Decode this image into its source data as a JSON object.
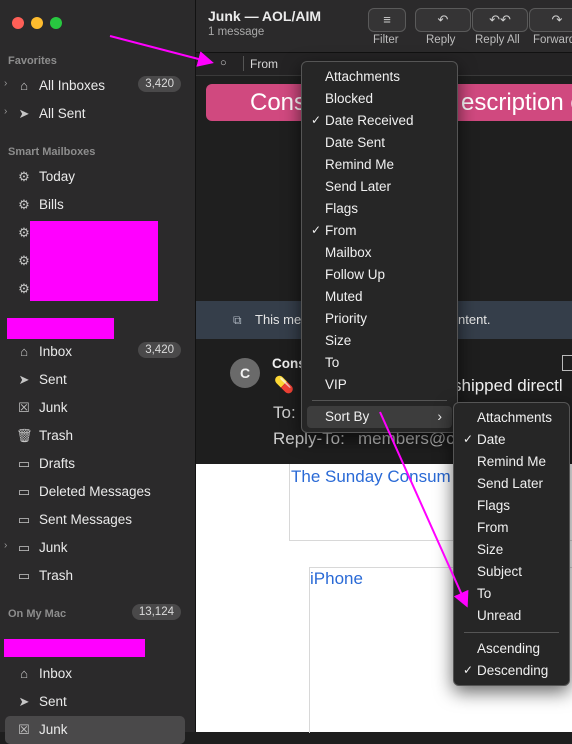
{
  "sidebar": {
    "favorites_title": "Favorites",
    "favorites": [
      {
        "label": "All Inboxes",
        "badge": "3,420"
      },
      {
        "label": "All Sent"
      }
    ],
    "smart_title": "Smart Mailboxes",
    "smart": [
      {
        "label": "Today"
      },
      {
        "label": "Bills"
      }
    ],
    "account": [
      {
        "label": "Inbox",
        "badge": "3,420"
      },
      {
        "label": "Sent"
      },
      {
        "label": "Junk"
      },
      {
        "label": "Trash"
      },
      {
        "label": "Drafts"
      },
      {
        "label": "Deleted Messages"
      },
      {
        "label": "Sent Messages"
      },
      {
        "label": "Junk"
      },
      {
        "label": "Trash"
      }
    ],
    "onmymac_title": "On My Mac",
    "onmymac_badge": "13,124",
    "mac": [
      {
        "label": "Inbox"
      },
      {
        "label": "Sent"
      },
      {
        "label": "Junk"
      }
    ]
  },
  "header": {
    "title": "Junk — AOL/AIM",
    "subtitle": "1 message"
  },
  "toolbar": {
    "filter": "Filter",
    "reply": "Reply",
    "reply_all": "Reply All",
    "forward": "Forward"
  },
  "list_header": {
    "sort_col": "From"
  },
  "banner_left": "Cons",
  "banner_right": "escription c",
  "infobar": {
    "left": "This me",
    "right": "ntent."
  },
  "message": {
    "avatar": "C",
    "sender": "Cons",
    "body_right": "shipped directl",
    "pill": "💊",
    "to_label": "To:",
    "replyto_label": "Reply-To:",
    "replyto_value": "members@c",
    "body1": "The Sunday Consum",
    "body2": "iPhone"
  },
  "columns_menu": {
    "items": [
      {
        "label": "Attachments",
        "checked": false
      },
      {
        "label": "Blocked",
        "checked": false
      },
      {
        "label": "Date Received",
        "checked": true
      },
      {
        "label": "Date Sent",
        "checked": false
      },
      {
        "label": "Remind Me",
        "checked": false
      },
      {
        "label": "Send Later",
        "checked": false
      },
      {
        "label": "Flags",
        "checked": false
      },
      {
        "label": "From",
        "checked": true
      },
      {
        "label": "Mailbox",
        "checked": false
      },
      {
        "label": "Follow Up",
        "checked": false
      },
      {
        "label": "Muted",
        "checked": false
      },
      {
        "label": "Priority",
        "checked": false
      },
      {
        "label": "Size",
        "checked": false
      },
      {
        "label": "To",
        "checked": false
      },
      {
        "label": "VIP",
        "checked": false
      }
    ],
    "sort_by": "Sort By"
  },
  "sort_menu": {
    "items": [
      {
        "label": "Attachments",
        "checked": false
      },
      {
        "label": "Date",
        "checked": true
      },
      {
        "label": "Remind Me",
        "checked": false
      },
      {
        "label": "Send Later",
        "checked": false
      },
      {
        "label": "Flags",
        "checked": false
      },
      {
        "label": "From",
        "checked": false
      },
      {
        "label": "Size",
        "checked": false
      },
      {
        "label": "Subject",
        "checked": false
      },
      {
        "label": "To",
        "checked": false
      },
      {
        "label": "Unread",
        "checked": false
      }
    ],
    "order": [
      {
        "label": "Ascending",
        "checked": false
      },
      {
        "label": "Descending",
        "checked": true
      }
    ]
  },
  "colors": {
    "accent": "#ff00ff",
    "banner": "#d0497f",
    "link": "#2a6ad6"
  }
}
